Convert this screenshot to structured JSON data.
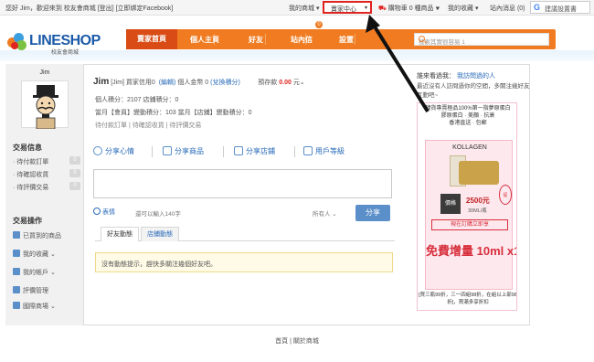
{
  "topbar": {
    "greeting": "您好 Jim，歡迎來到 校友會商城",
    "logout": "[登出]",
    "bind_fb": "[立即綁定Facebook]",
    "my_mall": "我的商城",
    "seller_center": "賣家中心",
    "cart": "購物車 0 種商品",
    "favorites": "我的收藏",
    "messages": "站內消息 (0)",
    "google_search": "建議設置書"
  },
  "logo": {
    "name": "LINESHOP",
    "subtitle": "校友會商城"
  },
  "nav": {
    "items": [
      "賣家首頁",
      "個人主頁",
      "好友",
      "站內信",
      "設置"
    ],
    "badge": "0",
    "search_placeholder": "搜索其實很容易 1"
  },
  "sidebar": {
    "username": "Jim",
    "trade_title": "交易信息",
    "trade_items": [
      {
        "label": "· 待付款訂單",
        "count": "0"
      },
      {
        "label": "· 待確認收貨",
        "count": "0"
      },
      {
        "label": "· 待評價交易",
        "count": "0"
      }
    ],
    "ops_title": "交易操作",
    "ops_items": [
      "已買到的商品",
      "我的收藏 ⌄",
      "我的帳戶 ⌄",
      "評價管理",
      "國際商場 ⌄"
    ]
  },
  "profile": {
    "name": "Jim",
    "tag": "[Jim]",
    "buyer_credit": "買家信用0",
    "edit_label": "(編輯)",
    "funds_label": "個人金幣",
    "funds_value": "0",
    "exchange": "(兌換積分)",
    "prepay_label": "預存款",
    "prepay_value": "0.00",
    "prepay_unit": "元⌄",
    "line2": "個人積分：2107     店鋪積分：0",
    "line3": "當月【會員】變動積分：103     當月【店鋪】變動積分：0",
    "line4": "待付款訂單  |  待確認收貨  |  待評價交易"
  },
  "share": {
    "tabs": [
      "分享心情",
      "分享商品",
      "分享店鋪",
      "用戶等級"
    ],
    "emoji_label": "表情",
    "count_text": "還可以輸入140字",
    "visibility": "所有人 ⌄",
    "button": "分享"
  },
  "feed": {
    "tabs": [
      "好友動態",
      "店鋪動態"
    ],
    "empty_notice": "沒有動態提示，趕快多關注幾個好友吧。"
  },
  "right": {
    "visitors_label": "誰來看過我：",
    "visitors_link": "我訪問過的人",
    "desc": "最近沒有人訪問過你的空間，多關注幾好友互動吧~",
    "ad_title": "韓貨專賣極品100%第一指夢原蛋白",
    "ad_line2": "膠原蛋白 · 美顏 · 抗衰",
    "ad_line3": "香港直送 · 包郵",
    "brand": "KOLLAGEN",
    "price_box": "價格",
    "price": "2500元",
    "unit": "30ML/瓶",
    "stamp": "促",
    "ribbon": "現在訂購立即享",
    "free": "免費增量 10ml x1",
    "bottom": "[買三瓶99折，三一四組98折，在組以上部98折]，買滿多享折扣"
  },
  "footer": {
    "text": "首頁  |  關於商城"
  },
  "colors": {
    "nav_orange": "#f07b20",
    "nav_active": "#d94c15",
    "link_blue": "#2a6bb8",
    "highlight_red": "#e0241f",
    "share_button": "#5b8fc9"
  }
}
